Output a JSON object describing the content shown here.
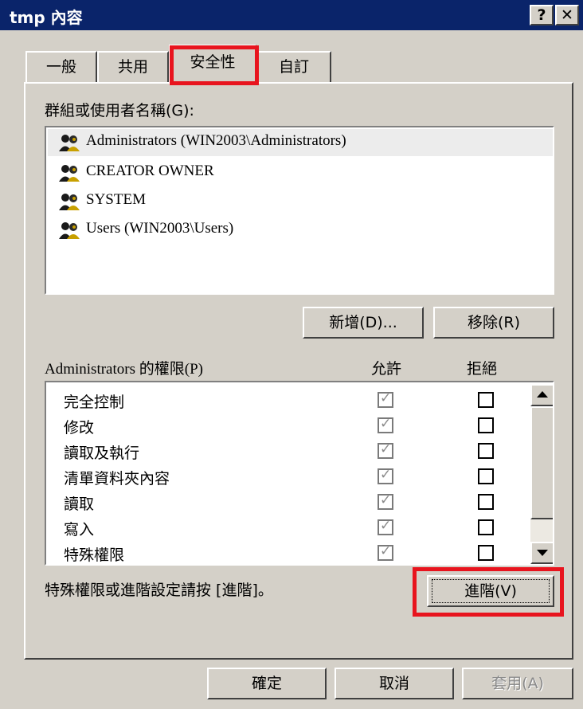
{
  "window": {
    "title": "tmp 內容",
    "help_label": "?",
    "close_label": "✕"
  },
  "tabs": [
    "一般",
    "共用",
    "安全性",
    "自訂"
  ],
  "groups_label": "群組或使用者名稱(G):",
  "users": [
    "Administrators (WIN2003\\Administrators)",
    "CREATOR OWNER",
    "SYSTEM",
    "Users (WIN2003\\Users)"
  ],
  "buttons": {
    "add": "新增(D)...",
    "remove": "移除(R)",
    "advanced": "進階(V)",
    "ok": "確定",
    "cancel": "取消",
    "apply": "套用(A)"
  },
  "perms": {
    "header": "Administrators 的權限(P)",
    "allow_header": "允許",
    "deny_header": "拒絕",
    "rows": [
      {
        "name": "完全控制",
        "allow": true,
        "deny": false
      },
      {
        "name": "修改",
        "allow": true,
        "deny": false
      },
      {
        "name": "讀取及執行",
        "allow": true,
        "deny": false
      },
      {
        "name": "清單資料夾內容",
        "allow": true,
        "deny": false
      },
      {
        "name": "讀取",
        "allow": true,
        "deny": false
      },
      {
        "name": "寫入",
        "allow": true,
        "deny": false
      },
      {
        "name": "特殊權限",
        "allow": false,
        "deny": false
      }
    ]
  },
  "hint": "特殊權限或進階設定請按 [進階]。",
  "colors": {
    "titlebar": "#0a246a",
    "dialog": "#d4d0c8",
    "highlight": "#e8141e"
  }
}
